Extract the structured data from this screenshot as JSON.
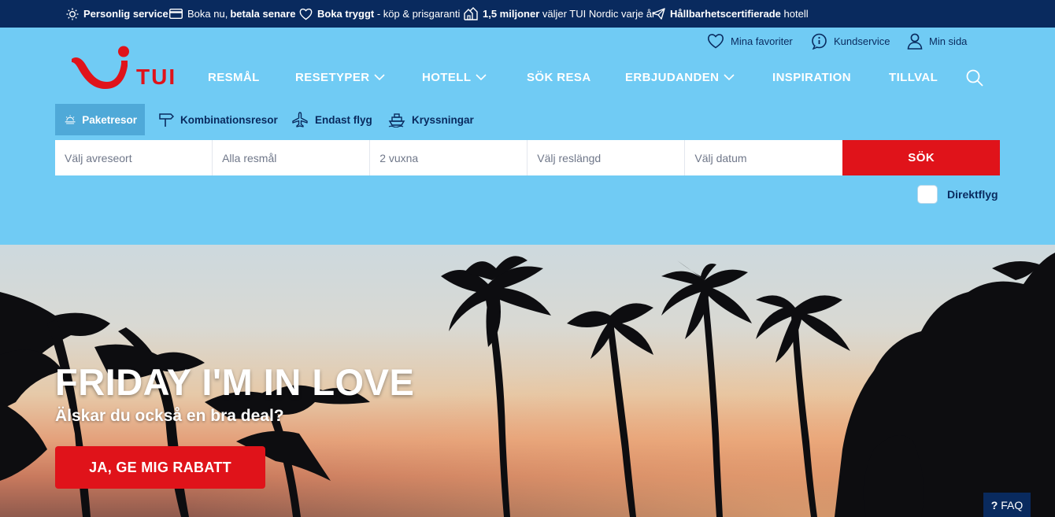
{
  "usp": [
    {
      "icon": "sun-icon",
      "bold": "Personlig service",
      "text": ""
    },
    {
      "icon": "card-icon",
      "bold": "",
      "text": "Boka nu, ",
      "bold2": "betala senare"
    },
    {
      "icon": "heart-icon",
      "bold": "Boka tryggt",
      "text": " - köp & prisgaranti"
    },
    {
      "icon": "people-icon",
      "bold": "1,5 miljoner",
      "text": " väljer TUI Nordic varje år"
    },
    {
      "icon": "paperplane-icon",
      "bold": "Hållbarhetscertifierade",
      "text": " hotell"
    }
  ],
  "utility": {
    "favorites": "Mina favoriter",
    "service": "Kundservice",
    "account": "Min sida"
  },
  "logo_text": "TUI",
  "nav": [
    {
      "label": "RESMÅL",
      "dropdown": false
    },
    {
      "label": "RESETYPER",
      "dropdown": true
    },
    {
      "label": "HOTELL",
      "dropdown": true
    },
    {
      "label": "SÖK RESA",
      "dropdown": false
    },
    {
      "label": "ERBJUDANDEN",
      "dropdown": true
    },
    {
      "label": "INSPIRATION",
      "dropdown": false
    },
    {
      "label": "TILLVAL",
      "dropdown": false
    }
  ],
  "product_tabs": [
    {
      "label": "Paketresor",
      "icon": "beach-sun-icon",
      "active": true
    },
    {
      "label": "Kombinationsresor",
      "icon": "signpost-icon",
      "active": false
    },
    {
      "label": "Endast flyg",
      "icon": "plane-icon",
      "active": false
    },
    {
      "label": "Kryssningar",
      "icon": "ship-icon",
      "active": false
    }
  ],
  "search": {
    "departure_placeholder": "Välj avreseort",
    "destination_placeholder": "Alla resmål",
    "travellers_placeholder": "2 vuxna",
    "duration_placeholder": "Välj reslängd",
    "date_placeholder": "Välj datum",
    "submit_label": "SÖK",
    "direct_flight_label": "Direktflyg",
    "direct_flight_checked": false
  },
  "hero": {
    "title": "FRIDAY I'M IN LOVE",
    "subtitle": "Älskar du också en bra deal?",
    "cta_label": "JA, GE MIG RABATT"
  },
  "faq": {
    "icon": "question-icon",
    "label": "FAQ"
  },
  "colors": {
    "navy": "#092a5e",
    "sky": "#70cbf4",
    "red": "#e0131a"
  }
}
